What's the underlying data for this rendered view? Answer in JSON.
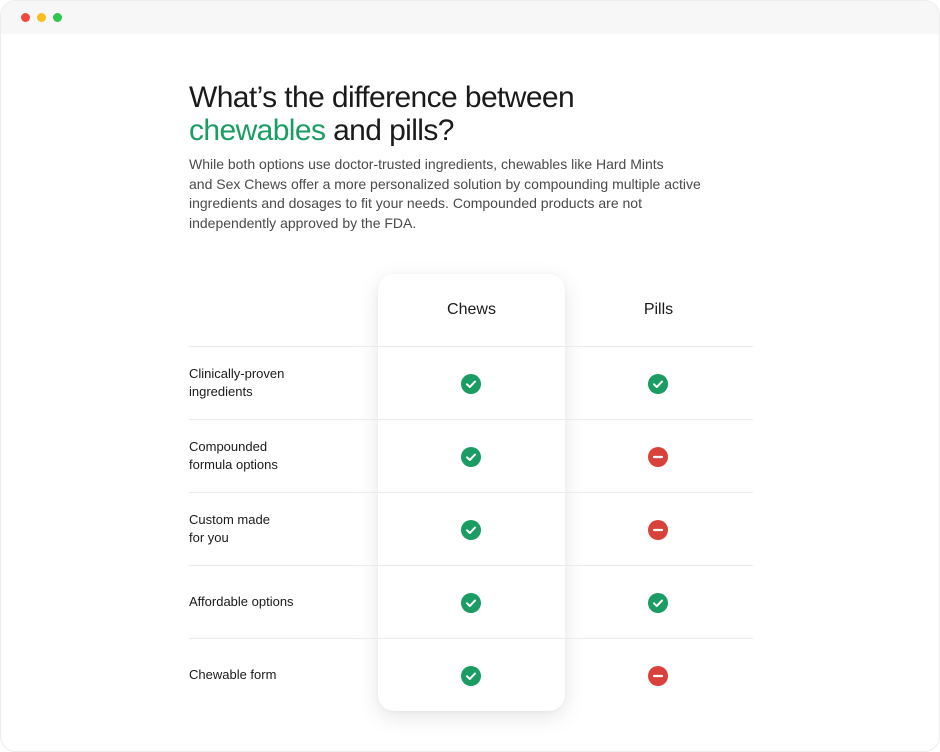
{
  "heading": {
    "line1": "What’s the difference between",
    "accent": "chewables",
    "line2_rest": " and pills?"
  },
  "intro": {
    "lines": [
      "While both options use doctor-trusted ingredients, chewables like Hard Mints",
      "and Sex Chews offer a more personalized solution by compounding multiple active",
      "ingredients and dosages to fit your needs. Compounded products are not",
      "independently approved by the FDA."
    ]
  },
  "columns": {
    "chews": "Chews",
    "pills": "Pills"
  },
  "rows": [
    {
      "label_lines": [
        "Clinically-proven",
        "ingredients"
      ],
      "chews": "check-icon",
      "pills": "check-icon"
    },
    {
      "label_lines": [
        "Compounded",
        "formula options"
      ],
      "chews": "check-icon",
      "pills": "minus-icon"
    },
    {
      "label_lines": [
        "Custom made",
        "for you"
      ],
      "chews": "check-icon",
      "pills": "minus-icon"
    },
    {
      "label_lines": [
        "Affordable options"
      ],
      "chews": "check-icon",
      "pills": "check-icon"
    },
    {
      "label_lines": [
        "Chewable form"
      ],
      "chews": "check-icon",
      "pills": "minus-icon"
    }
  ],
  "colors": {
    "accent": "#1a9c62",
    "yes": "#1a9c62",
    "no": "#d9423a"
  }
}
